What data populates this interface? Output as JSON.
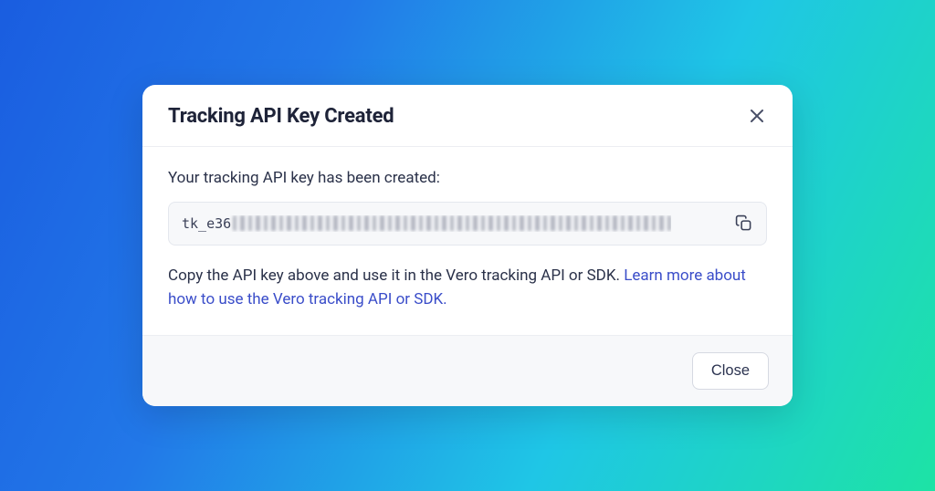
{
  "modal": {
    "title": "Tracking API Key Created",
    "intro_text": "Your tracking API key has been created:",
    "api_key_prefix": "tk_e36",
    "helper_text_before_link": "Copy the API key above and use it in the Vero tracking API or SDK. ",
    "helper_link_text": "Learn more about how to use the Vero tracking API or SDK.",
    "close_button_label": "Close"
  }
}
